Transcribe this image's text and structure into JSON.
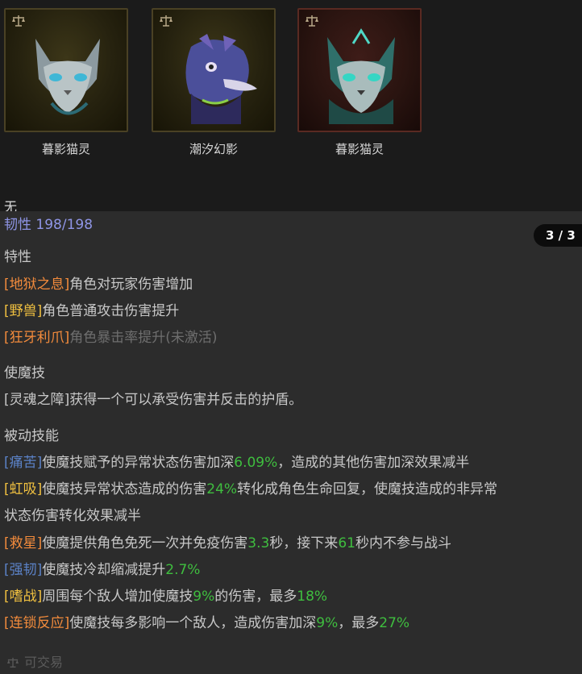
{
  "cards": [
    {
      "name": "暮影猫灵",
      "icon": "scale-icon",
      "variant": "gold"
    },
    {
      "name": "潮汐幻影",
      "icon": "scale-icon",
      "variant": "gold"
    },
    {
      "name": "暮影猫灵",
      "icon": "scale-icon",
      "variant": "red"
    }
  ],
  "none_label": "无",
  "toughness": {
    "label": "韧性",
    "value": "198/198"
  },
  "pager": "3 / 3",
  "traits": {
    "title": "特性",
    "items": [
      {
        "tag": "[地狱之息]",
        "text": "角色对玩家伤害增加"
      },
      {
        "tag": "[野兽]",
        "text": "角色普通攻击伤害提升"
      },
      {
        "tag": "[狂牙利爪]",
        "text": "角色暴击率提升(未激活)"
      }
    ]
  },
  "skill": {
    "title": "使魔技",
    "text": "[灵魂之障]获得一个可以承受伤害并反击的护盾。"
  },
  "passives": {
    "title": "被动技能",
    "items": [
      {
        "tag": "[痛苦]",
        "t1": "使魔技赋予的异常状态伤害加深",
        "n1": "6.09%",
        "t2": "，造成的其他伤害加深效果减半"
      },
      {
        "tag": "[虹吸]",
        "t1": "使魔技异常状态造成的伤害",
        "n1": "24%",
        "t2": "转化成角色生命回复，使魔技造成的非异常",
        "t3": "状态伤害转化效果减半"
      },
      {
        "tag": "[救星]",
        "t1": "使魔提供角色免死一次并免疫伤害",
        "n1": "3.3",
        "t2": "秒，接下来",
        "n2": "61",
        "t3": "秒内不参与战斗"
      },
      {
        "tag": "[强韧]",
        "t1": "使魔技冷却缩减提升",
        "n1": "2.7%"
      },
      {
        "tag": "[嗜战]",
        "t1": "周围每个敌人增加使魔技",
        "n1": "9%",
        "t2": "的伤害，最多",
        "n2": "18%"
      },
      {
        "tag": "[连锁反应]",
        "t1": "使魔技每多影响一个敌人，造成伤害加深",
        "n1": "9%",
        "t2": "，最多",
        "n2": "27%"
      }
    ]
  },
  "tradeable": "可交易",
  "colors": {
    "toughness": "#8f95e6",
    "tag_orange": "#f28b3c",
    "tag_yellow": "#f0c040",
    "tag_blue": "#5b82c7",
    "number_green": "#3fbe3f"
  }
}
